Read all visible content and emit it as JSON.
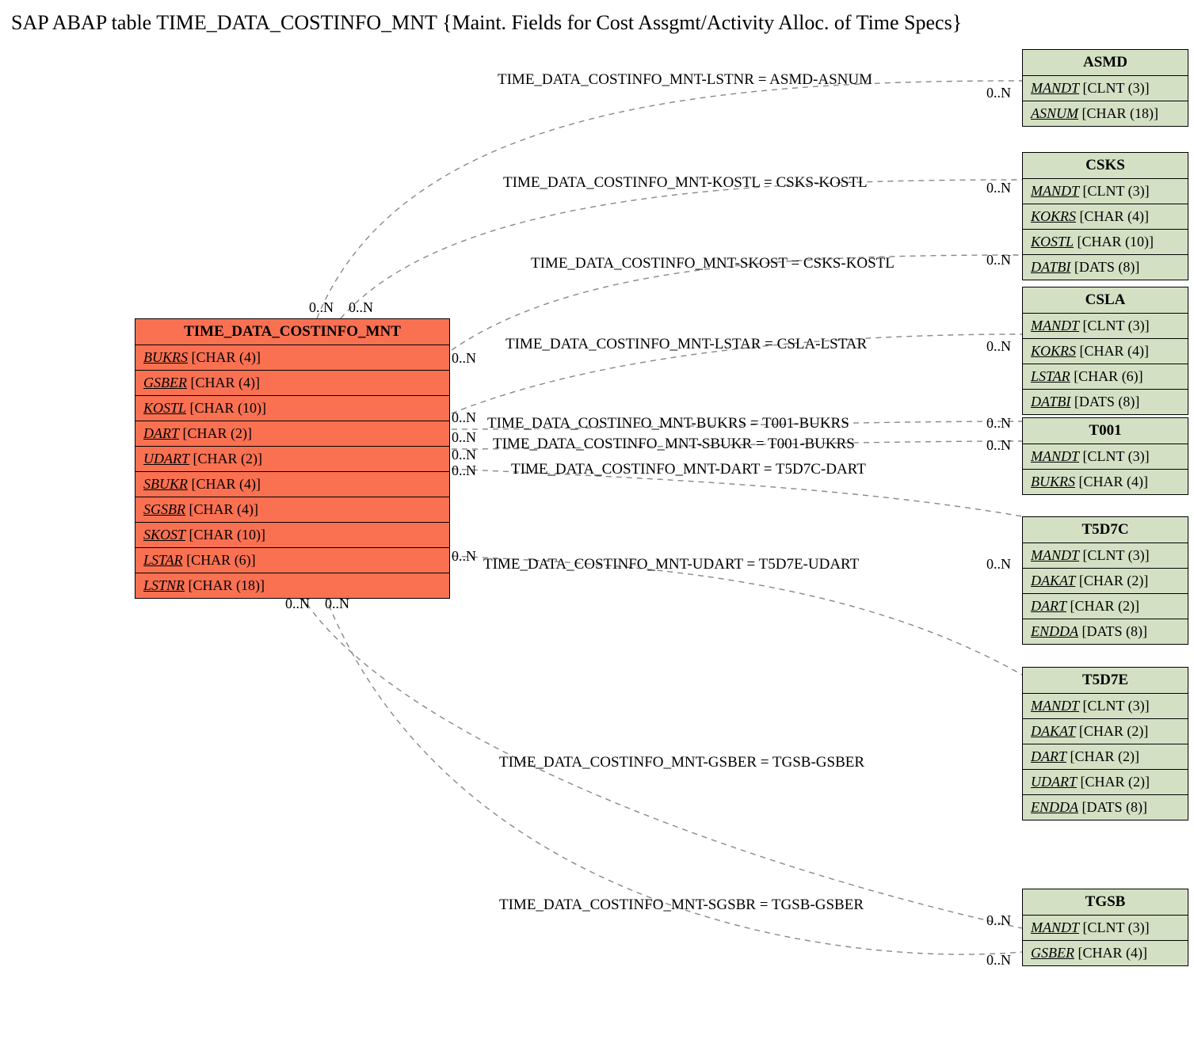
{
  "title": "SAP ABAP table TIME_DATA_COSTINFO_MNT {Maint. Fields for Cost Assgmt/Activity Alloc. of Time Specs}",
  "main_table": {
    "name": "TIME_DATA_COSTINFO_MNT",
    "fields": [
      {
        "name": "BUKRS",
        "type": "[CHAR (4)]"
      },
      {
        "name": "GSBER",
        "type": "[CHAR (4)]"
      },
      {
        "name": "KOSTL",
        "type": "[CHAR (10)]"
      },
      {
        "name": "DART",
        "type": "[CHAR (2)]"
      },
      {
        "name": "UDART",
        "type": "[CHAR (2)]"
      },
      {
        "name": "SBUKR",
        "type": "[CHAR (4)]"
      },
      {
        "name": "SGSBR",
        "type": "[CHAR (4)]"
      },
      {
        "name": "SKOST",
        "type": "[CHAR (10)]"
      },
      {
        "name": "LSTAR",
        "type": "[CHAR (6)]"
      },
      {
        "name": "LSTNR",
        "type": "[CHAR (18)]"
      }
    ]
  },
  "ref_tables": [
    {
      "name": "ASMD",
      "fields": [
        {
          "name": "MANDT",
          "type": "[CLNT (3)]"
        },
        {
          "name": "ASNUM",
          "type": "[CHAR (18)]"
        }
      ]
    },
    {
      "name": "CSKS",
      "fields": [
        {
          "name": "MANDT",
          "type": "[CLNT (3)]"
        },
        {
          "name": "KOKRS",
          "type": "[CHAR (4)]"
        },
        {
          "name": "KOSTL",
          "type": "[CHAR (10)]"
        },
        {
          "name": "DATBI",
          "type": "[DATS (8)]"
        }
      ]
    },
    {
      "name": "CSLA",
      "fields": [
        {
          "name": "MANDT",
          "type": "[CLNT (3)]"
        },
        {
          "name": "KOKRS",
          "type": "[CHAR (4)]"
        },
        {
          "name": "LSTAR",
          "type": "[CHAR (6)]"
        },
        {
          "name": "DATBI",
          "type": "[DATS (8)]"
        }
      ]
    },
    {
      "name": "T001",
      "fields": [
        {
          "name": "MANDT",
          "type": "[CLNT (3)]"
        },
        {
          "name": "BUKRS",
          "type": "[CHAR (4)]"
        }
      ]
    },
    {
      "name": "T5D7C",
      "fields": [
        {
          "name": "MANDT",
          "type": "[CLNT (3)]"
        },
        {
          "name": "DAKAT",
          "type": "[CHAR (2)]"
        },
        {
          "name": "DART",
          "type": "[CHAR (2)]"
        },
        {
          "name": "ENDDA",
          "type": "[DATS (8)]"
        }
      ]
    },
    {
      "name": "T5D7E",
      "fields": [
        {
          "name": "MANDT",
          "type": "[CLNT (3)]"
        },
        {
          "name": "DAKAT",
          "type": "[CHAR (2)]"
        },
        {
          "name": "DART",
          "type": "[CHAR (2)]"
        },
        {
          "name": "UDART",
          "type": "[CHAR (2)]"
        },
        {
          "name": "ENDDA",
          "type": "[DATS (8)]"
        }
      ]
    },
    {
      "name": "TGSB",
      "fields": [
        {
          "name": "MANDT",
          "type": "[CLNT (3)]"
        },
        {
          "name": "GSBER",
          "type": "[CHAR (4)]"
        }
      ]
    }
  ],
  "relations": [
    {
      "label": "TIME_DATA_COSTINFO_MNT-LSTNR = ASMD-ASNUM"
    },
    {
      "label": "TIME_DATA_COSTINFO_MNT-KOSTL = CSKS-KOSTL"
    },
    {
      "label": "TIME_DATA_COSTINFO_MNT-SKOST = CSKS-KOSTL"
    },
    {
      "label": "TIME_DATA_COSTINFO_MNT-LSTAR = CSLA-LSTAR"
    },
    {
      "label": "TIME_DATA_COSTINFO_MNT-BUKRS = T001-BUKRS"
    },
    {
      "label": "TIME_DATA_COSTINFO_MNT-SBUKR = T001-BUKRS"
    },
    {
      "label": "TIME_DATA_COSTINFO_MNT-DART = T5D7C-DART"
    },
    {
      "label": "TIME_DATA_COSTINFO_MNT-UDART = T5D7E-UDART"
    },
    {
      "label": "TIME_DATA_COSTINFO_MNT-GSBER = TGSB-GSBER"
    },
    {
      "label": "TIME_DATA_COSTINFO_MNT-SGSBR = TGSB-GSBER"
    }
  ],
  "card": "0..N"
}
